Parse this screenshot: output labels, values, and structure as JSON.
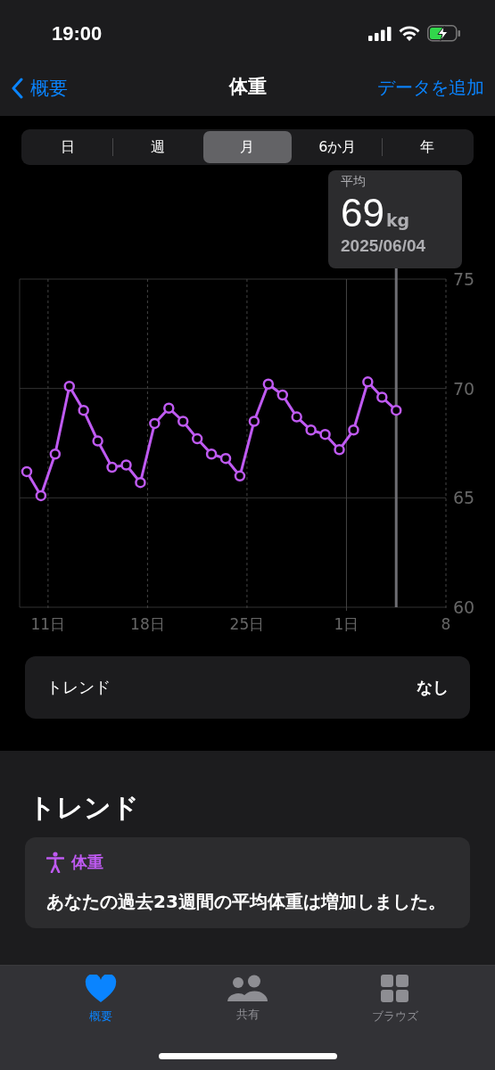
{
  "status_bar": {
    "time": "19:00"
  },
  "nav": {
    "back": "概要",
    "title": "体重",
    "action": "データを追加"
  },
  "segments": [
    {
      "label": "日",
      "selected": false
    },
    {
      "label": "週",
      "selected": false
    },
    {
      "label": "月",
      "selected": true
    },
    {
      "label": "6か月",
      "selected": false
    },
    {
      "label": "年",
      "selected": false
    }
  ],
  "tooltip": {
    "label": "平均",
    "value": "69",
    "unit": "kg",
    "date": "2025/06/04"
  },
  "chart_data": {
    "type": "line",
    "x": [
      "2025-05-09T12:00",
      "2025-05-10T12:00",
      "2025-05-11T12:00",
      "2025-05-12T12:00",
      "2025-05-13T12:00",
      "2025-05-14T12:00",
      "2025-05-15T12:00",
      "2025-05-16T12:00",
      "2025-05-17T12:00",
      "2025-05-18T12:00",
      "2025-05-19T12:00",
      "2025-05-20T12:00",
      "2025-05-21T12:00",
      "2025-05-22T12:00",
      "2025-05-23T12:00",
      "2025-05-24T12:00",
      "2025-05-25T12:00",
      "2025-05-26T12:00",
      "2025-05-27T12:00",
      "2025-05-28T12:00",
      "2025-05-29T12:00",
      "2025-05-30T12:00",
      "2025-05-31T12:00",
      "2025-06-01T12:00",
      "2025-06-02T12:00",
      "2025-06-03T12:00",
      "2025-06-04T12:00"
    ],
    "series": [
      {
        "color": "#bf5af2",
        "marker": "o",
        "values": [
          66.2,
          65.1,
          67.0,
          70.1,
          69.0,
          67.6,
          66.4,
          66.5,
          65.7,
          68.4,
          69.1,
          68.5,
          67.7,
          67.0,
          66.8,
          66.0,
          68.5,
          70.2,
          69.7,
          68.7,
          68.1,
          67.9,
          67.2,
          68.1,
          70.3,
          69.6,
          69.0
        ]
      }
    ],
    "xlim": [
      "2025-05-09T00:00",
      "2025-06-08T00:00"
    ],
    "ylim": [
      60,
      75
    ],
    "xticks": [
      {
        "value": "2025-05-11T00:00",
        "label": "11日"
      },
      {
        "value": "2025-05-18T00:00",
        "label": "18日"
      },
      {
        "value": "2025-05-25T00:00",
        "label": "25日"
      },
      {
        "value": "2025-06-01T00:00",
        "label": "1日"
      },
      {
        "value": "2025-06-08T00:00",
        "label": "8"
      }
    ],
    "yticks": [
      60,
      65,
      70,
      75
    ],
    "grid": true,
    "ref_lines": [
      {
        "axis": "x",
        "value": "2025-06-01T00:00",
        "color": "#444444"
      },
      {
        "axis": "x",
        "value": "2025-06-04T12:00",
        "color": "#6e6e73"
      }
    ]
  },
  "trend_row": {
    "label": "トレンド",
    "value": "なし"
  },
  "trend_section": {
    "heading": "トレンド",
    "card_title": "体重",
    "card_text": "あなたの過去23週間の平均体重は増加しました。"
  },
  "tab_bar": [
    {
      "label": "概要",
      "selected": true,
      "kind": "heart"
    },
    {
      "label": "共有",
      "selected": false,
      "kind": "people"
    },
    {
      "label": "ブラウズ",
      "selected": false,
      "kind": "grid"
    }
  ]
}
